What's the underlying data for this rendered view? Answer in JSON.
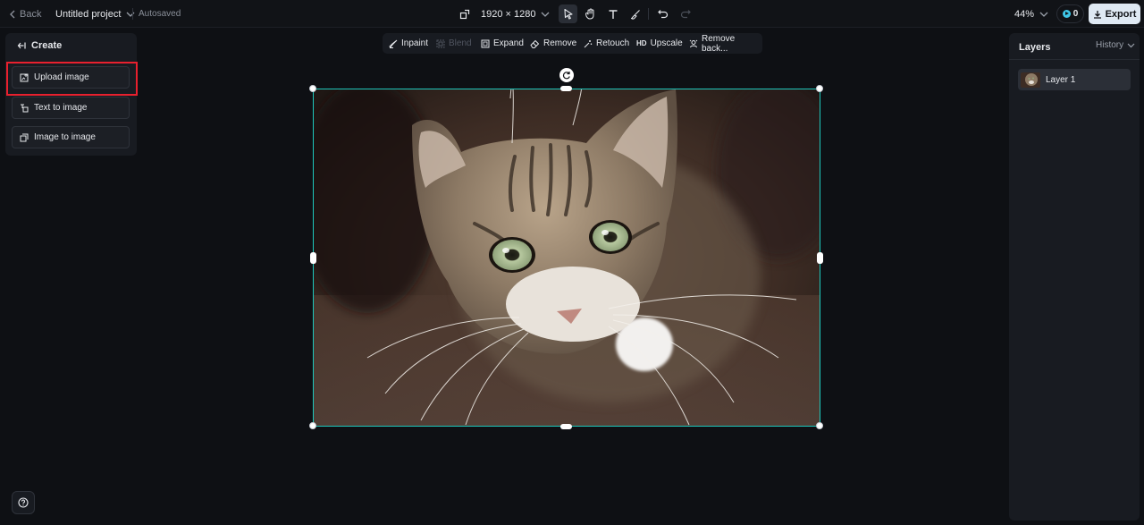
{
  "topbar": {
    "back_label": "Back",
    "project_title": "Untitled project",
    "autosave_status": "Autosaved",
    "canvas_size": "1920 × 1280",
    "zoom": "44%",
    "credits": "0",
    "export_label": "Export"
  },
  "tools": [
    "select-icon",
    "hand-icon",
    "text-icon",
    "brush-icon",
    "undo-icon",
    "redo-icon"
  ],
  "create_panel": {
    "title": "Create",
    "buttons": [
      {
        "label": "Upload image",
        "icon": "upload-image-icon"
      },
      {
        "label": "Text to image",
        "icon": "text-to-image-icon"
      },
      {
        "label": "Image to image",
        "icon": "image-to-image-icon"
      }
    ]
  },
  "edit_toolbar": {
    "items": [
      {
        "label": "Inpaint",
        "icon": "inpaint-icon"
      },
      {
        "label": "Blend",
        "icon": "blend-icon",
        "disabled": true
      },
      {
        "label": "Expand",
        "icon": "expand-icon"
      },
      {
        "label": "Remove",
        "icon": "eraser-icon"
      },
      {
        "label": "Retouch",
        "icon": "retouch-icon"
      },
      {
        "label": "Upscale",
        "icon": "hd-icon",
        "badge": "HD"
      },
      {
        "label": "Remove back...",
        "icon": "remove-background-icon"
      }
    ]
  },
  "right_panel": {
    "tab_layers": "Layers",
    "tab_history": "History",
    "layers": [
      {
        "name": "Layer 1"
      }
    ]
  },
  "colors": {
    "accent_selection": "#1ec7bc",
    "highlight": "#e8202e",
    "export_bg": "#dfe9f3"
  }
}
